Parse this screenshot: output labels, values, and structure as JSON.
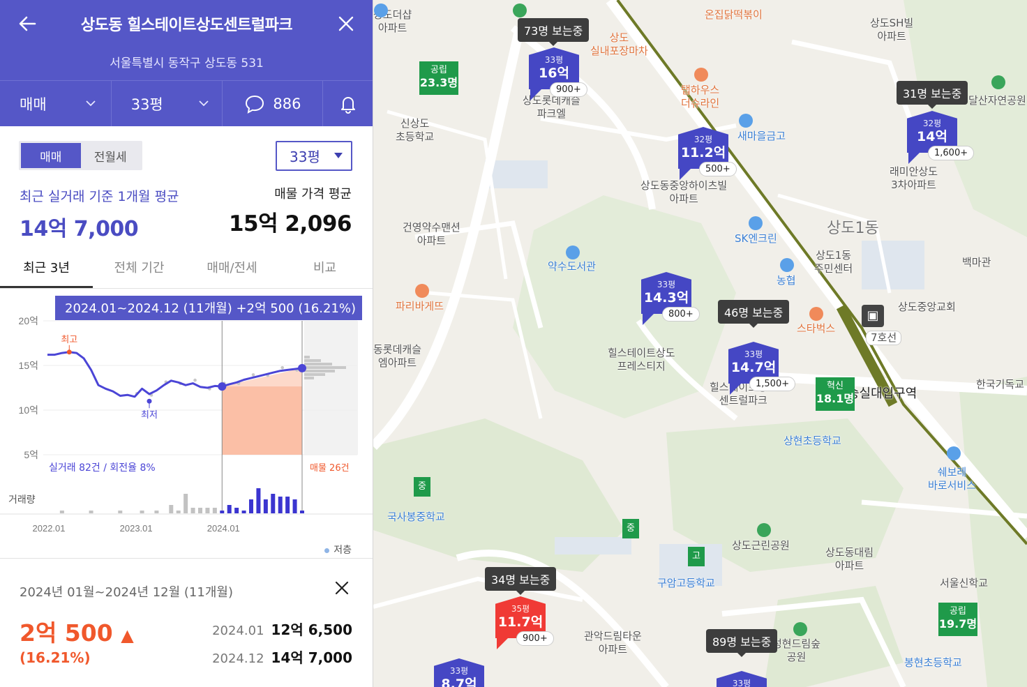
{
  "header": {
    "title": "상도동 힐스테이트상도센트럴파크",
    "address": "서울특별시 동작구 상도동 531",
    "deal_type": "매매",
    "size": "33평",
    "comments": "886"
  },
  "summary": {
    "tabs": [
      "매매",
      "전월세"
    ],
    "size_select": "33평",
    "recent_label": "최근 실거래 기준 1개월 평균",
    "recent_price": "14억 7,000",
    "listing_label": "매물 가격 평균",
    "listing_price": "15억 2,096"
  },
  "period_tabs": [
    "최근 3년",
    "전체 기간",
    "매매/전세",
    "비교"
  ],
  "chart": {
    "tooltip": "2024.01~2024.12 (11개월)  +2억 500 (16.21%)",
    "high_label": "최고",
    "low_label": "최저",
    "trades_label": "실거래 82건 / 회전율 8%",
    "listings_label": "매물 26건",
    "volume_label": "거래량",
    "low_floor_label": "저층"
  },
  "chart_data": {
    "type": "line",
    "ylabel": "",
    "y_ticks": [
      "20억",
      "15억",
      "10억",
      "5억"
    ],
    "ylim": [
      5,
      20
    ],
    "x_ticks": [
      "2022.01",
      "2023.01",
      "2024.01"
    ],
    "x": [
      "2022.01",
      "2022.02",
      "2022.03",
      "2022.04",
      "2022.05",
      "2022.06",
      "2022.07",
      "2022.08",
      "2022.09",
      "2022.10",
      "2022.11",
      "2022.12",
      "2023.01",
      "2023.02",
      "2023.03",
      "2023.04",
      "2023.05",
      "2023.06",
      "2023.07",
      "2023.08",
      "2023.09",
      "2023.10",
      "2023.11",
      "2023.12",
      "2024.01",
      "2024.02",
      "2024.03",
      "2024.04",
      "2024.05",
      "2024.06",
      "2024.07",
      "2024.08",
      "2024.09",
      "2024.10",
      "2024.11",
      "2024.12"
    ],
    "series": [
      {
        "values": [
          16.2,
          16.2,
          16.4,
          16.5,
          16.4,
          15.8,
          14.5,
          12.8,
          12.4,
          12.1,
          11.6,
          11.7,
          11.5,
          12.4,
          11.8,
          12.2,
          12.8,
          13.3,
          13.1,
          12.8,
          13.0,
          12.6,
          12.5,
          12.7,
          12.65,
          12.9,
          13.1,
          13.4,
          13.6,
          13.8,
          14.0,
          14.2,
          14.4,
          14.5,
          14.6,
          14.7
        ]
      }
    ],
    "volume": [
      0,
      0,
      1,
      0,
      0,
      0,
      1,
      0,
      0,
      0,
      1,
      0,
      0,
      1,
      0,
      1,
      0,
      3,
      1,
      7,
      2,
      2,
      2,
      2,
      1,
      3,
      2,
      1,
      5,
      9,
      5,
      7,
      6,
      6,
      5,
      1
    ],
    "high": 16.5,
    "low": 11.0
  },
  "detail": {
    "range": "2024년 01월~2024년 12월 (11개월)",
    "change": "2억 500",
    "pct": "(16.21%)",
    "from_date": "2024.01",
    "from_price": "12억 6,500",
    "to_date": "2024.12",
    "to_price": "14억 7,000"
  },
  "map": {
    "areas": [
      {
        "name": "상도1동",
        "big": true
      },
      {
        "name": "신상도\n초등학교"
      },
      {
        "name": "건영약수맨션\n아파트"
      },
      {
        "name": "약수도서관"
      },
      {
        "name": "파리바게뜨"
      },
      {
        "name": "동롯데캐슬\n엠아파트"
      },
      {
        "name": "힐스테이트상도\n프레스티지"
      },
      {
        "name": "상도동중앙하이츠빌\n아파트"
      },
      {
        "name": "SK엔크린"
      },
      {
        "name": "새마을금고"
      },
      {
        "name": "농협"
      },
      {
        "name": "상도1동\n주민센터"
      },
      {
        "name": "스타벅스"
      },
      {
        "name": "상현초등학교"
      },
      {
        "name": "숭실대입구역"
      },
      {
        "name": "7호선"
      },
      {
        "name": "상도중앙교회"
      },
      {
        "name": "한국기독교"
      },
      {
        "name": "백마관"
      },
      {
        "name": "래미안상도\n3차아파트"
      },
      {
        "name": "상도SH빌\n아파트"
      },
      {
        "name": "국사봉중학교"
      },
      {
        "name": "상도근린공원"
      },
      {
        "name": "구암고등학교"
      },
      {
        "name": "상도동대림\n아파트"
      },
      {
        "name": "서울신학교"
      },
      {
        "name": "관악드림타운\n아파트"
      },
      {
        "name": "성현드림숲\n공원"
      },
      {
        "name": "봉현초등학교"
      },
      {
        "name": "쉐보레\n바로서비스"
      },
      {
        "name": "탭하우스\n더슈라인"
      },
      {
        "name": "상도\n실내포장마차"
      },
      {
        "name": "온집닭떡볶이"
      },
      {
        "name": "상도롯데캐슬\n파크엘"
      },
      {
        "name": "상도더샵\n아파트"
      },
      {
        "name": "힐스테이트상도\n센트럴파크"
      },
      {
        "name": "달산자연공원"
      }
    ],
    "pins": [
      {
        "size": "33평",
        "price": "16억",
        "count": "900+"
      },
      {
        "size": "32평",
        "price": "11.2억",
        "count": "500+"
      },
      {
        "size": "32평",
        "price": "14억",
        "count": "1,600+"
      },
      {
        "size": "33평",
        "price": "14.3억",
        "count": "800+"
      },
      {
        "size": "33평",
        "price": "14.7억",
        "count": "1,500+"
      },
      {
        "size": "35평",
        "price": "11.7억",
        "count": "900+"
      },
      {
        "size": "33평",
        "price": "8.7억",
        "count": ""
      },
      {
        "size": "33평",
        "price": "",
        "count": ""
      }
    ],
    "viewers": [
      "73명 보는중",
      "31명 보는중",
      "46명 보는중",
      "34명 보는중",
      "89명 보는중"
    ],
    "flags": [
      {
        "label": "공립",
        "value": "23.3명"
      },
      {
        "label": "혁신",
        "value": "18.1명"
      },
      {
        "label": "공립",
        "value": "19.7명"
      }
    ],
    "minis": [
      "중",
      "중",
      "고"
    ]
  }
}
